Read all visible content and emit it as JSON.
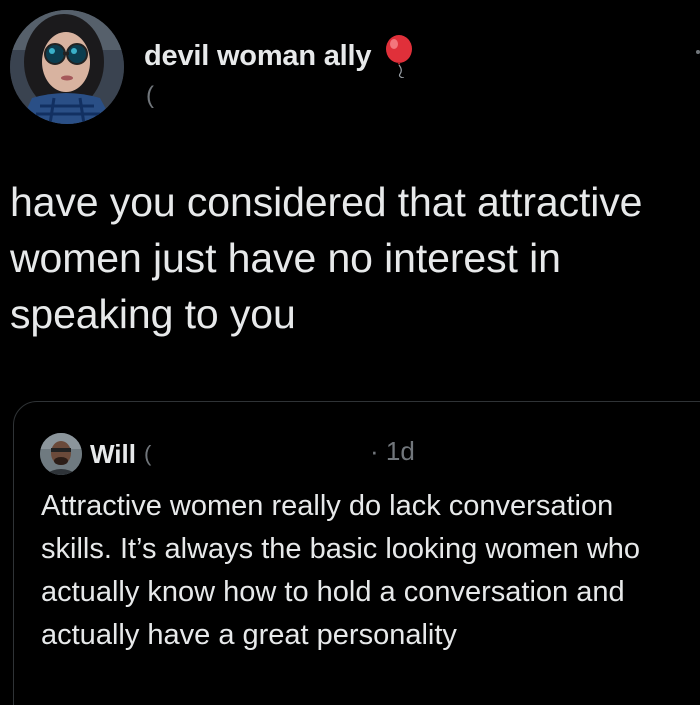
{
  "tweet": {
    "author": {
      "display_name": "devil woman ally",
      "handle_fragment": "(",
      "avatar_icon": "profile-avatar",
      "name_emoji_icon": "balloon-icon"
    },
    "text": "have you considered that attractive women just have no interest in speaking to you"
  },
  "quoted_tweet": {
    "author": {
      "display_name": "Will",
      "handle_fragment": "(",
      "avatar_icon": "profile-avatar"
    },
    "time": "· 1d",
    "text": "Attractive women really do lack conversation skills. It’s always the basic looking women who actually know how to hold a conversation and actually have a great personality"
  },
  "colors": {
    "background": "#000000",
    "primary_text": "#e7e9ea",
    "secondary_text": "#71767b",
    "border": "#2f3336",
    "balloon": "#e0303a"
  }
}
